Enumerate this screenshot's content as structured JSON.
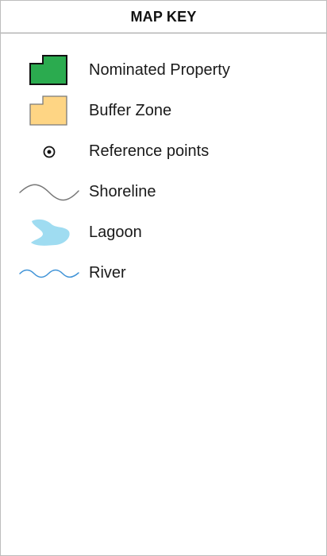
{
  "header": {
    "title": "MAP KEY"
  },
  "legend": {
    "items": [
      {
        "label": "Nominated Property",
        "icon": "nominated-property-polygon",
        "fill": "#2bab4f",
        "stroke": "#111111"
      },
      {
        "label": "Buffer Zone",
        "icon": "buffer-zone-polygon",
        "fill": "#fed584",
        "stroke": "#7a7a7a"
      },
      {
        "label": "Reference points",
        "icon": "reference-point-marker",
        "fill": "#ffffff",
        "stroke": "#111111"
      },
      {
        "label": "Shoreline",
        "icon": "shoreline-line",
        "stroke": "#777777"
      },
      {
        "label": "Lagoon",
        "icon": "lagoon-shape",
        "fill": "#9fdcf1"
      },
      {
        "label": "River",
        "icon": "river-line",
        "stroke": "#3f93d7"
      }
    ]
  }
}
